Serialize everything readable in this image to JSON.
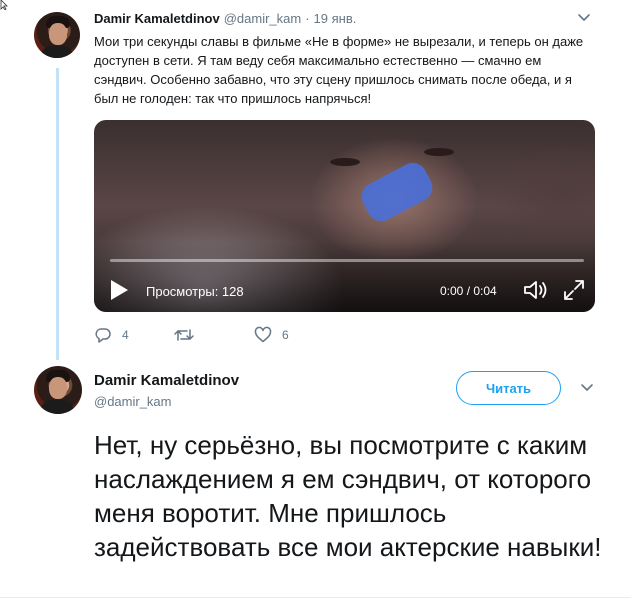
{
  "tweet1": {
    "author_name": "Damir Kamaletdinov",
    "author_handle": "@damir_kam",
    "separator": "·",
    "date": "19 янв.",
    "text": "Мои три секунды славы в фильме «Не в форме» не вырезали, и теперь он даже доступен в сети. Я там веду себя максимально естественно — смачно ем сэндвич. Особенно забавно, что эту сцену пришлось снимать после обеда, и я был не голоден: так что пришлось напрячься!",
    "video": {
      "views_label": "Просмотры: 128",
      "time": "0:00 / 0:04",
      "progress": 0.0
    },
    "actions": {
      "replies": "4",
      "retweets": "",
      "likes": "6"
    }
  },
  "tweet2": {
    "author_name": "Damir Kamaletdinov",
    "author_handle": "@damir_kam",
    "follow_label": "Читать",
    "text": "Нет, ну серьёзно, вы посмотрите с каким наслаждением я ем сэндвич, от которого меня воротит. Мне пришлось задействовать все мои актерские навыки!"
  },
  "colors": {
    "accent": "#1da1f2",
    "thread_line": "#c4e2f7",
    "secondary_text": "#657786"
  },
  "icons": [
    "reply-icon",
    "retweet-icon",
    "like-icon",
    "play-icon",
    "volume-icon",
    "fullscreen-icon",
    "chevron-down-icon"
  ]
}
